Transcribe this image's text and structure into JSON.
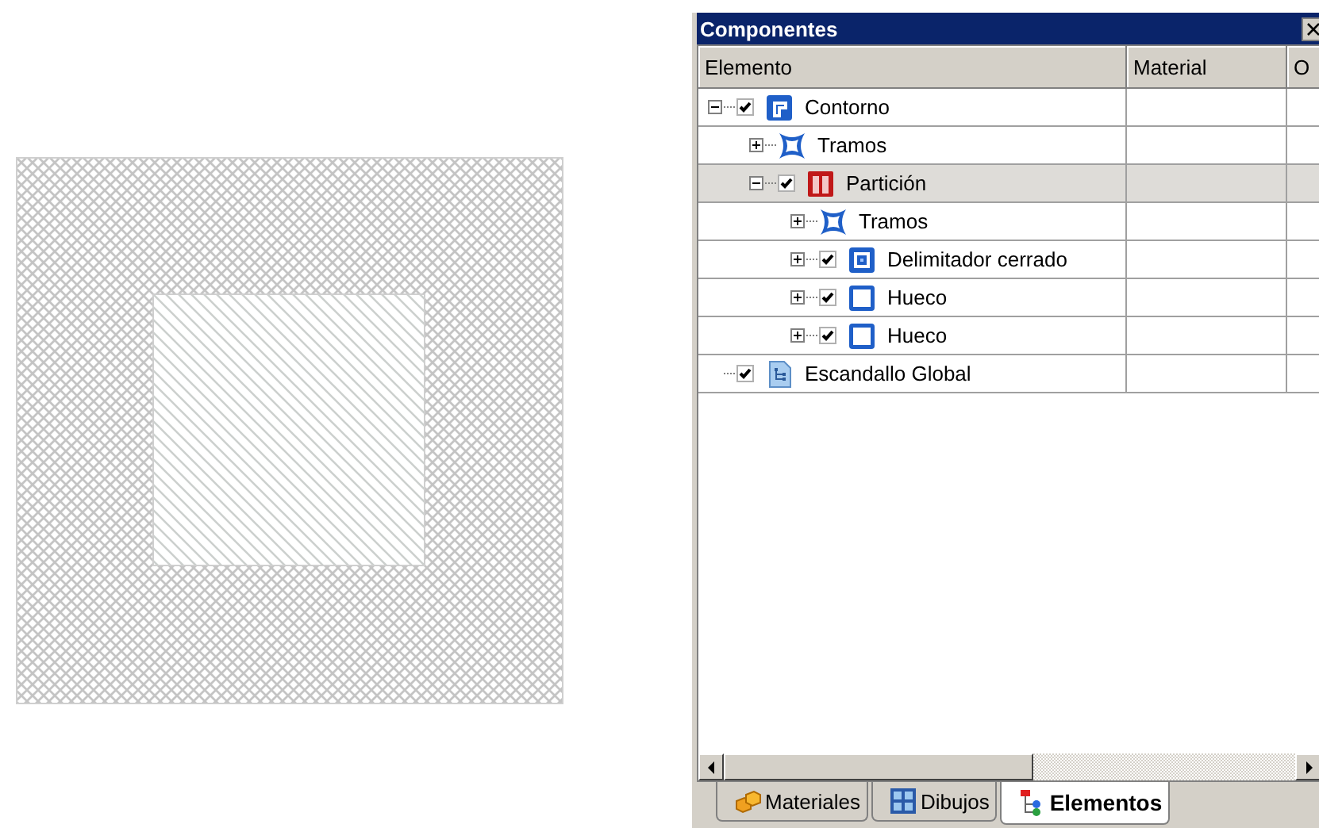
{
  "panel": {
    "title": "Componentes",
    "columns": [
      "Elemento",
      "Material",
      "O"
    ],
    "tree": [
      {
        "label": "Contorno",
        "kind": "contour",
        "expanded": true,
        "checked": true,
        "selected": false,
        "children": [
          {
            "label": "Tramos",
            "kind": "spans",
            "expanded": false,
            "selected": false
          },
          {
            "label": "Partición",
            "kind": "partition",
            "expanded": true,
            "checked": true,
            "selected": true,
            "children": [
              {
                "label": "Tramos",
                "kind": "spans",
                "expanded": false,
                "selected": false
              },
              {
                "label": "Delimitador cerrado",
                "kind": "boundary",
                "expanded": false,
                "checked": true,
                "selected": false
              },
              {
                "label": "Hueco",
                "kind": "opening",
                "expanded": false,
                "checked": true,
                "selected": false
              },
              {
                "label": "Hueco",
                "kind": "opening",
                "expanded": false,
                "checked": true,
                "selected": false
              }
            ]
          }
        ]
      },
      {
        "label": "Escandallo Global",
        "kind": "costing",
        "checked": true,
        "selected": false
      }
    ],
    "tabs": [
      {
        "label": "Materiales",
        "kind": "materials",
        "selected": false
      },
      {
        "label": "Dibujos",
        "kind": "drawings",
        "selected": false
      },
      {
        "label": "Elementos",
        "kind": "elements",
        "selected": true
      }
    ]
  }
}
